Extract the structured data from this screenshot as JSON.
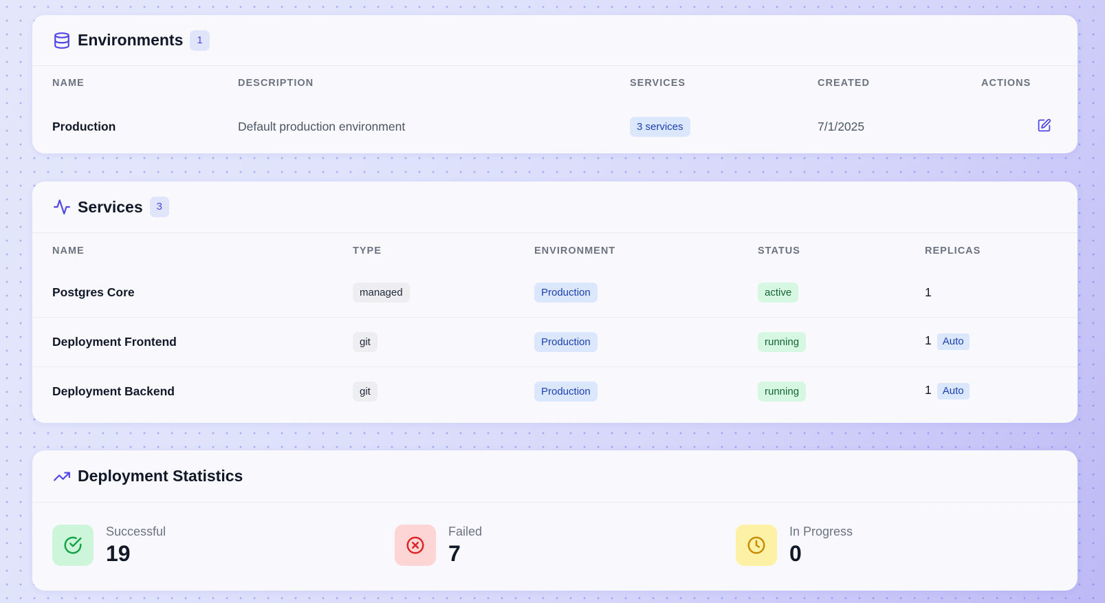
{
  "environments": {
    "title": "Environments",
    "count": "1",
    "columns": [
      "NAME",
      "DESCRIPTION",
      "SERVICES",
      "CREATED",
      "ACTIONS"
    ],
    "rows": [
      {
        "name": "Production",
        "description": "Default production environment",
        "services": "3 services",
        "created": "7/1/2025",
        "action_icon": "edit-icon"
      }
    ]
  },
  "services": {
    "title": "Services",
    "count": "3",
    "columns": [
      "NAME",
      "TYPE",
      "ENVIRONMENT",
      "STATUS",
      "REPLICAS"
    ],
    "rows": [
      {
        "name": "Postgres Core",
        "type": "managed",
        "environment": "Production",
        "status": "active",
        "replicas": "1",
        "auto": ""
      },
      {
        "name": "Deployment Frontend",
        "type": "git",
        "environment": "Production",
        "status": "running",
        "replicas": "1",
        "auto": "Auto"
      },
      {
        "name": "Deployment Backend",
        "type": "git",
        "environment": "Production",
        "status": "running",
        "replicas": "1",
        "auto": "Auto"
      }
    ]
  },
  "statistics": {
    "title": "Deployment Statistics",
    "items": [
      {
        "label": "Successful",
        "value": "19",
        "icon": "check-circle-icon",
        "color": "#16a34a",
        "bg": "#cdf5d9"
      },
      {
        "label": "Failed",
        "value": "7",
        "icon": "x-circle-icon",
        "color": "#dc2626",
        "bg": "#fdd5d5"
      },
      {
        "label": "In Progress",
        "value": "0",
        "icon": "clock-icon",
        "color": "#ca8a04",
        "bg": "#fdf1a6"
      }
    ]
  },
  "colors": {
    "accent": "#4f46e5",
    "badge_blue_bg": "#dbe7fd",
    "badge_green_bg": "#d6f7e1"
  }
}
